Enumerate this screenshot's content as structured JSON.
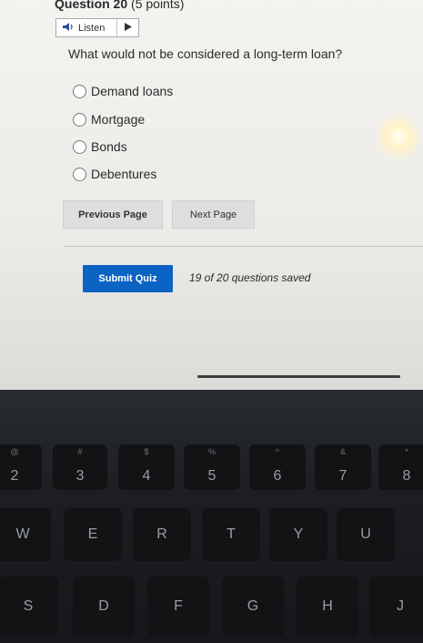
{
  "question": {
    "number_label": "Question 20",
    "points_label": "(5 points)",
    "listen_label": "Listen",
    "prompt": "What would not be considered a long-term loan?",
    "options": [
      "Demand loans",
      "Mortgage",
      "Bonds",
      "Debentures"
    ]
  },
  "nav": {
    "previous_label": "Previous Page",
    "next_label": "Next Page"
  },
  "footer": {
    "submit_label": "Submit Quiz",
    "saved_status": "19 of 20 questions saved"
  },
  "keyboard": {
    "number_row": [
      {
        "top": "@",
        "main": "2"
      },
      {
        "top": "#",
        "main": "3"
      },
      {
        "top": "$",
        "main": "4"
      },
      {
        "top": "%",
        "main": "5"
      },
      {
        "top": "^",
        "main": "6"
      },
      {
        "top": "&",
        "main": "7"
      },
      {
        "top": "*",
        "main": "8"
      }
    ],
    "row_qwerty": [
      "W",
      "E",
      "R",
      "T",
      "Y",
      "U"
    ],
    "row_asdf": [
      "S",
      "D",
      "F",
      "G",
      "H",
      "J"
    ]
  },
  "colors": {
    "submit_bg": "#0b63c4",
    "page_bg": "#f4f3f0",
    "keyboard_bg": "#1c1e21"
  },
  "icons": {
    "listen": "speaker-icon",
    "play": "play-triangle-icon"
  }
}
